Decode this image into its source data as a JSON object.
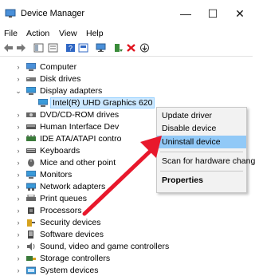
{
  "window": {
    "title": "Device Manager",
    "minimize_glyph": "—",
    "maximize_glyph": "☐",
    "close_glyph": "✕"
  },
  "menu": [
    "File",
    "Action",
    "View",
    "Help"
  ],
  "tree": [
    {
      "label": "Computer",
      "icon": "computer-icon",
      "arrow": "›"
    },
    {
      "label": "Disk drives",
      "icon": "disk-drive-icon",
      "arrow": "›"
    },
    {
      "label": "Display adapters",
      "icon": "display-adapter-icon",
      "arrow": "⌄"
    },
    {
      "label": "Intel(R) UHD Graphics 620",
      "icon": "display-adapter-icon",
      "arrow": ""
    },
    {
      "label": "DVD/CD-ROM drives",
      "icon": "dvd-drive-icon",
      "arrow": "›"
    },
    {
      "label": "Human Interface Dev",
      "icon": "hid-icon",
      "arrow": "›"
    },
    {
      "label": "IDE ATA/ATAPI contro",
      "icon": "ide-controller-icon",
      "arrow": "›"
    },
    {
      "label": "Keyboards",
      "icon": "keyboard-icon",
      "arrow": "›"
    },
    {
      "label": "Mice and other point",
      "icon": "mouse-icon",
      "arrow": "›"
    },
    {
      "label": "Monitors",
      "icon": "monitor-icon",
      "arrow": "›"
    },
    {
      "label": "Network adapters",
      "icon": "network-adapter-icon",
      "arrow": "›"
    },
    {
      "label": "Print queues",
      "icon": "printer-icon",
      "arrow": "›"
    },
    {
      "label": "Processors",
      "icon": "processor-icon",
      "arrow": "›"
    },
    {
      "label": "Security devices",
      "icon": "security-icon",
      "arrow": "›"
    },
    {
      "label": "Software devices",
      "icon": "software-device-icon",
      "arrow": "›"
    },
    {
      "label": "Sound, video and game controllers",
      "icon": "sound-icon",
      "arrow": "›"
    },
    {
      "label": "Storage controllers",
      "icon": "storage-controller-icon",
      "arrow": "›"
    },
    {
      "label": "System devices",
      "icon": "system-device-icon",
      "arrow": "›"
    }
  ],
  "context_menu": {
    "update_driver": "Update driver",
    "disable_device": "Disable device",
    "uninstall_device": "Uninstall device",
    "scan_hardware": "Scan for hardware changes",
    "properties": "Properties"
  },
  "colors": {
    "highlight": "#91c9f7",
    "selection": "#cce8ff",
    "annotation_arrow": "#e8182c",
    "remove_x": "#e0141e"
  }
}
